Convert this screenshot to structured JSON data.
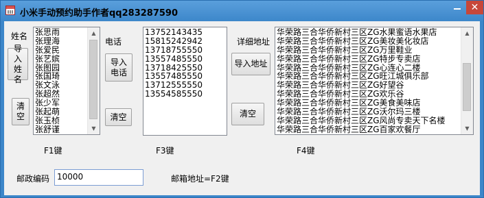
{
  "window": {
    "title": "小米手动预约助手作者qq283287590",
    "close_glyph": "✕"
  },
  "names": {
    "label": "姓名",
    "import_button": "导入姓名",
    "clear_button": "清空",
    "items": [
      "张思雨",
      "张理海",
      "张爱民",
      "张艺嫔",
      "张图园",
      "张国琦",
      "张文泳",
      "张超然",
      "张少军",
      "张起萌",
      "张玉桢",
      "张舒谨"
    ]
  },
  "phones": {
    "label": "电话",
    "import_button": "导入电话",
    "clear_button": "清空",
    "items": [
      "13752143435",
      "15815242942",
      "13718755550",
      "13557485550",
      "13718425550",
      "13557485550",
      "13712555550",
      "13554585550"
    ]
  },
  "addresses": {
    "label": "详细地址",
    "import_button": "导入地址",
    "clear_button": "清空",
    "items": [
      "华荣路三合华侨新村三区ZG水果蜜语水果店",
      "华荣路三合华侨新村三区ZG美妆美化妆店",
      "华荣路三合华侨新村三区ZG万里鞋业",
      "华荣路三合华侨新村三区ZG特步专卖店",
      "华荣路三合华侨新村三区ZG心连心二楼",
      "华荣路三合华侨新村三区ZG旺江城俱乐部",
      "华荣路三合华侨新村三区ZG好望谷",
      "华荣路三合华侨新村三区ZG欢乐谷",
      "华荣路三合华侨新村三区ZG美食美味店",
      "华荣路三合华侨新村三区ZG沃尔玛三楼",
      "华荣路三合华侨新村三区ZG风尚专卖天下名楼",
      "华荣路三合华侨新村三区ZG百家欢餐厅"
    ]
  },
  "hotkeys": {
    "f1": "F1键",
    "f3": "F3键",
    "f4": "F4键"
  },
  "postal": {
    "label": "邮政编码",
    "value": "10000"
  },
  "email_hint": "邮箱地址=F2键"
}
